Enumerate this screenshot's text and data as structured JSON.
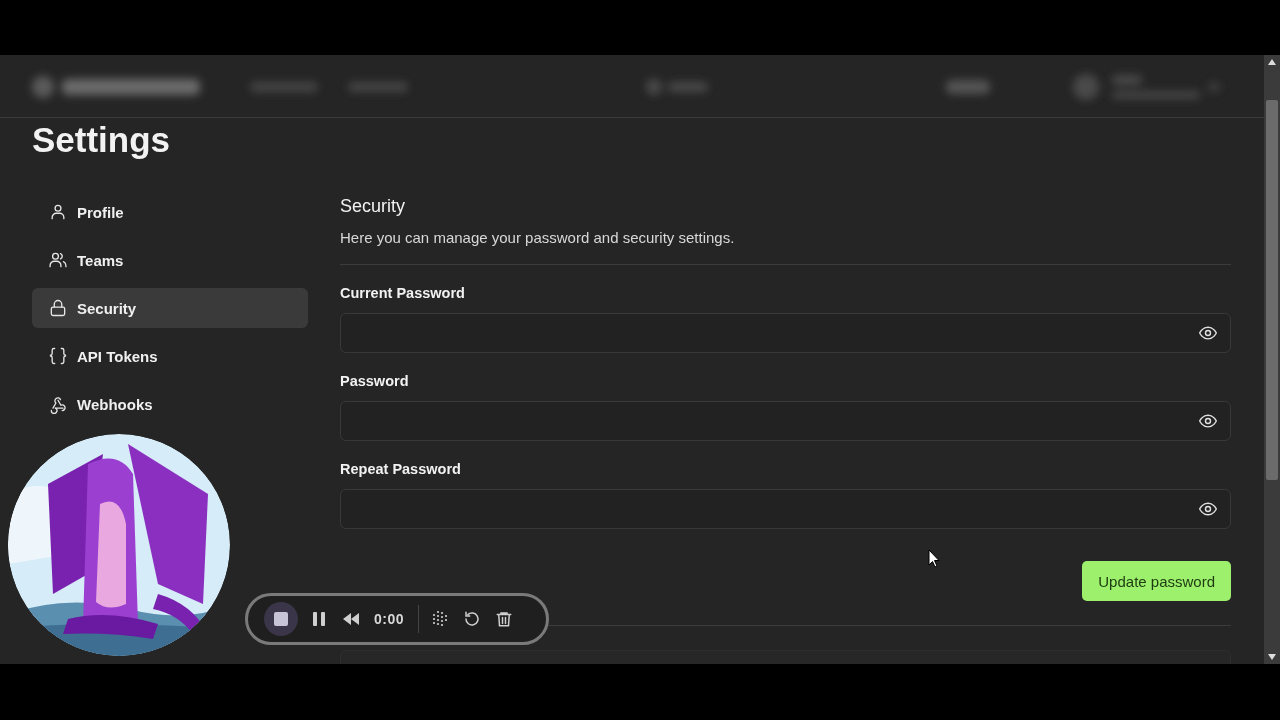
{
  "page_title": "Settings",
  "sidebar": {
    "items": [
      {
        "label": "Profile",
        "selected": false
      },
      {
        "label": "Teams",
        "selected": false
      },
      {
        "label": "Security",
        "selected": true
      },
      {
        "label": "API Tokens",
        "selected": false
      },
      {
        "label": "Webhooks",
        "selected": false
      }
    ]
  },
  "section": {
    "title": "Security",
    "description": "Here you can manage your password and security settings."
  },
  "fields": [
    {
      "label": "Current Password"
    },
    {
      "label": "Password"
    },
    {
      "label": "Repeat Password"
    }
  ],
  "submit_button": "Update password",
  "recorder": {
    "time": "0:00"
  }
}
